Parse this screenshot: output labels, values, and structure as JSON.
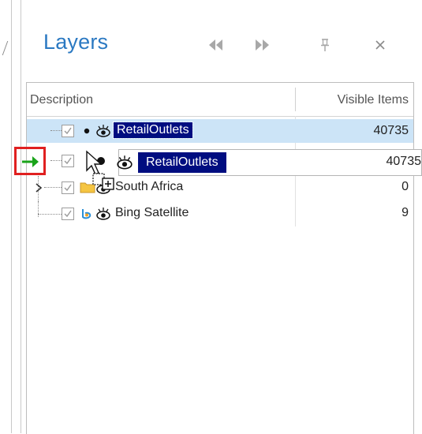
{
  "panel": {
    "title": "Layers",
    "buttons": {
      "prev": "double-left-arrow",
      "next": "double-right-arrow",
      "pin": "pin-icon",
      "close": "close-icon"
    }
  },
  "grid": {
    "columns": [
      "Description",
      "Visible Items"
    ],
    "rows": [
      {
        "name": "RetailOutlets",
        "value": "40735",
        "selected": true
      },
      {
        "name": "South Africa",
        "value": "0"
      },
      {
        "name": "Bing Satellite",
        "value": "9"
      }
    ]
  },
  "drag": {
    "name": "RetailOutlets",
    "value": "40735"
  },
  "colors": {
    "title": "#2b79c2",
    "selection": "#cce4f7",
    "highlight": "#000d80",
    "indicator_border": "#e02020",
    "arrow": "#1aa31a"
  }
}
